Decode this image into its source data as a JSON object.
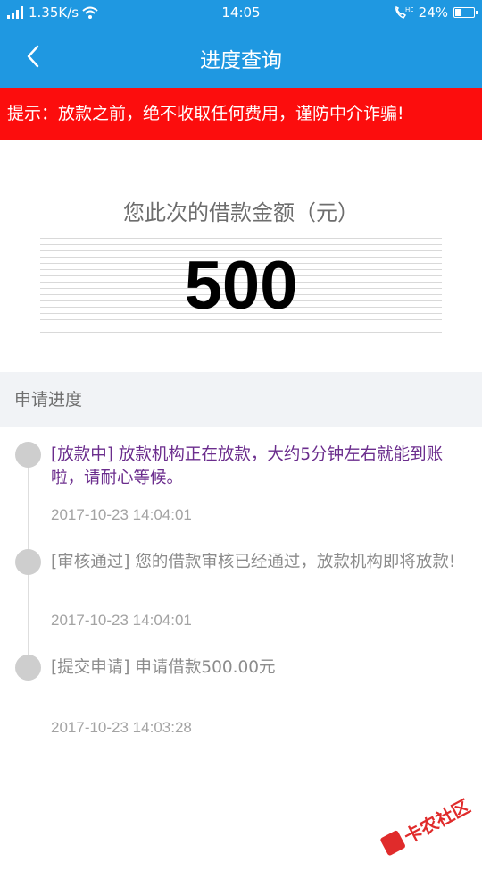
{
  "status_bar": {
    "network_speed": "1.35K/s",
    "time": "14:05",
    "battery_percent": "24%"
  },
  "nav": {
    "title": "进度查询"
  },
  "notice": {
    "text": "提示：放款之前，绝不收取任何费用，谨防中介诈骗!"
  },
  "amount": {
    "label": "您此次的借款金额（元）",
    "value": "500"
  },
  "progress": {
    "header": "申请进度",
    "items": [
      {
        "text": "[放款中] 放款机构正在放款，大约5分钟左右就能到账啦，请耐心等候。",
        "time": "2017-10-23 14:04:01",
        "active": true
      },
      {
        "text": "[审核通过] 您的借款审核已经通过，放款机构即将放款!",
        "time": "2017-10-23 14:04:01",
        "active": false
      },
      {
        "text": "[提交申请] 申请借款500.00元",
        "time": "2017-10-23 14:03:28",
        "active": false
      }
    ]
  },
  "watermark": {
    "text": "卡农社区"
  },
  "colors": {
    "brand": "#1f98e1",
    "notice": "#fc0d0d",
    "active_text": "#6b2d8d"
  }
}
